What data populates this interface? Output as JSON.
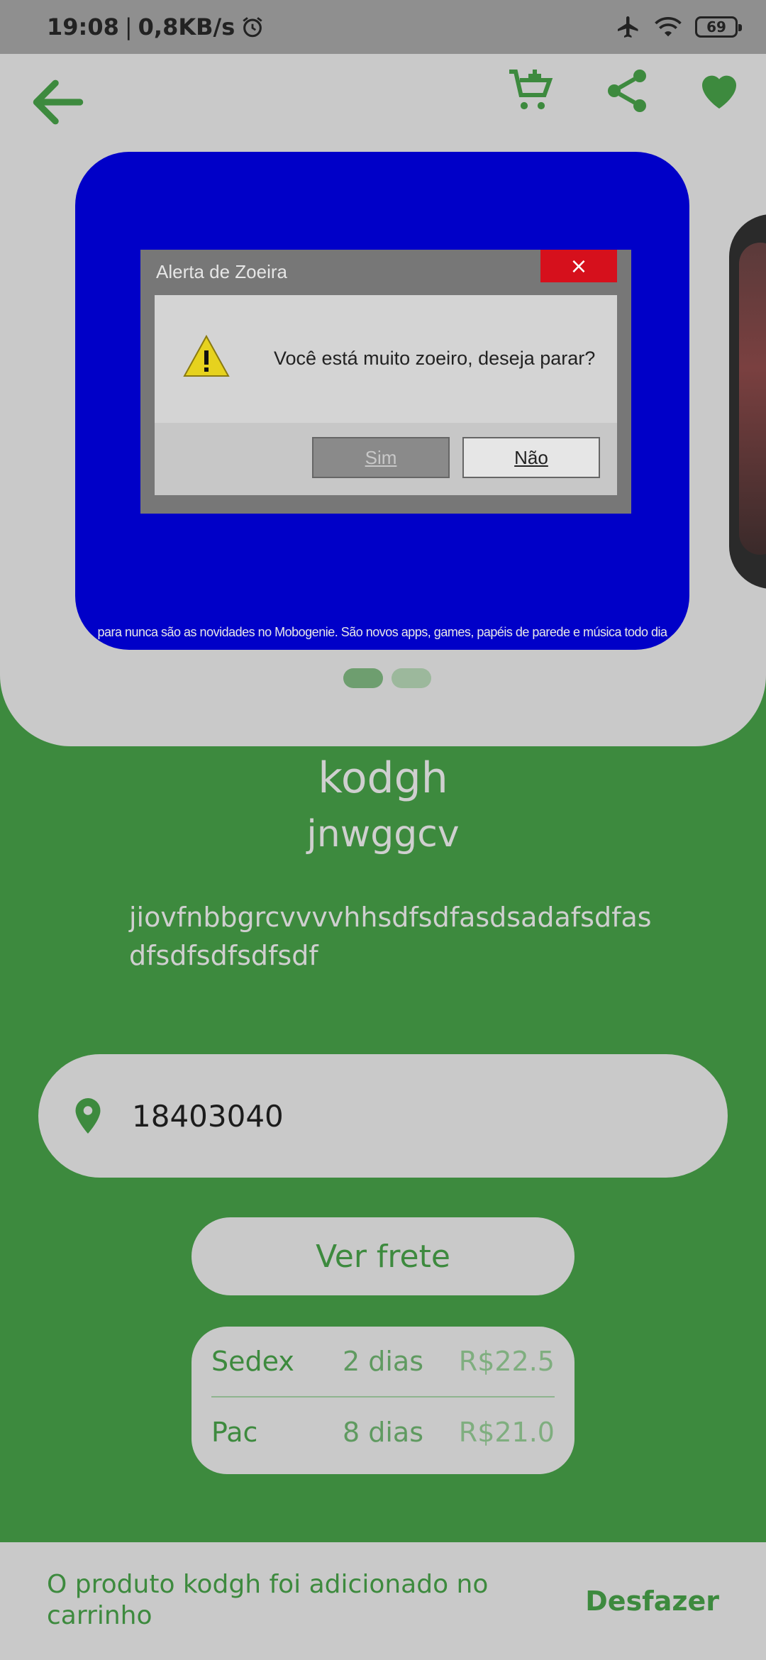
{
  "status_bar": {
    "time": "19:08",
    "separator": "|",
    "speed": "0,8KB/s",
    "battery": "69"
  },
  "toolbar": {
    "back_icon": "arrow-left-icon",
    "cart_icon": "cart-add-icon",
    "share_icon": "share-icon",
    "favorite_icon": "heart-icon"
  },
  "carousel": {
    "dialog_title": "Alerta de Zoeira",
    "dialog_close": "×",
    "dialog_message": "Você está muito zoeiro, deseja parar?",
    "dialog_yes": "Sim",
    "dialog_no": "Não",
    "ticker": "para nunca são as novidades no Mobogenie. São novos apps, games, papéis de parede e música todo dia",
    "active_index": 0,
    "count": 2
  },
  "product": {
    "name": "kodgh",
    "subtitle": "jnwggcv",
    "description": "jiovfnbbgrcvvvvhhsdfsdfasdsadafsdfasdfsdfsdfsdfsdf"
  },
  "shipping": {
    "cep_value": "18403040",
    "calc_button": "Ver frete",
    "options": [
      {
        "name": "Sedex",
        "days": "2 dias",
        "price": "R$22.5"
      },
      {
        "name": "Pac",
        "days": "8 dias",
        "price": "R$21.0"
      }
    ]
  },
  "snackbar": {
    "message": "O produto kodgh foi adicionado no carrinho",
    "action": "Desfazer"
  },
  "colors": {
    "primary_green": "#3d8a3e",
    "card_gray": "#c9c9c9",
    "status_bar": "#8f8f8f"
  }
}
